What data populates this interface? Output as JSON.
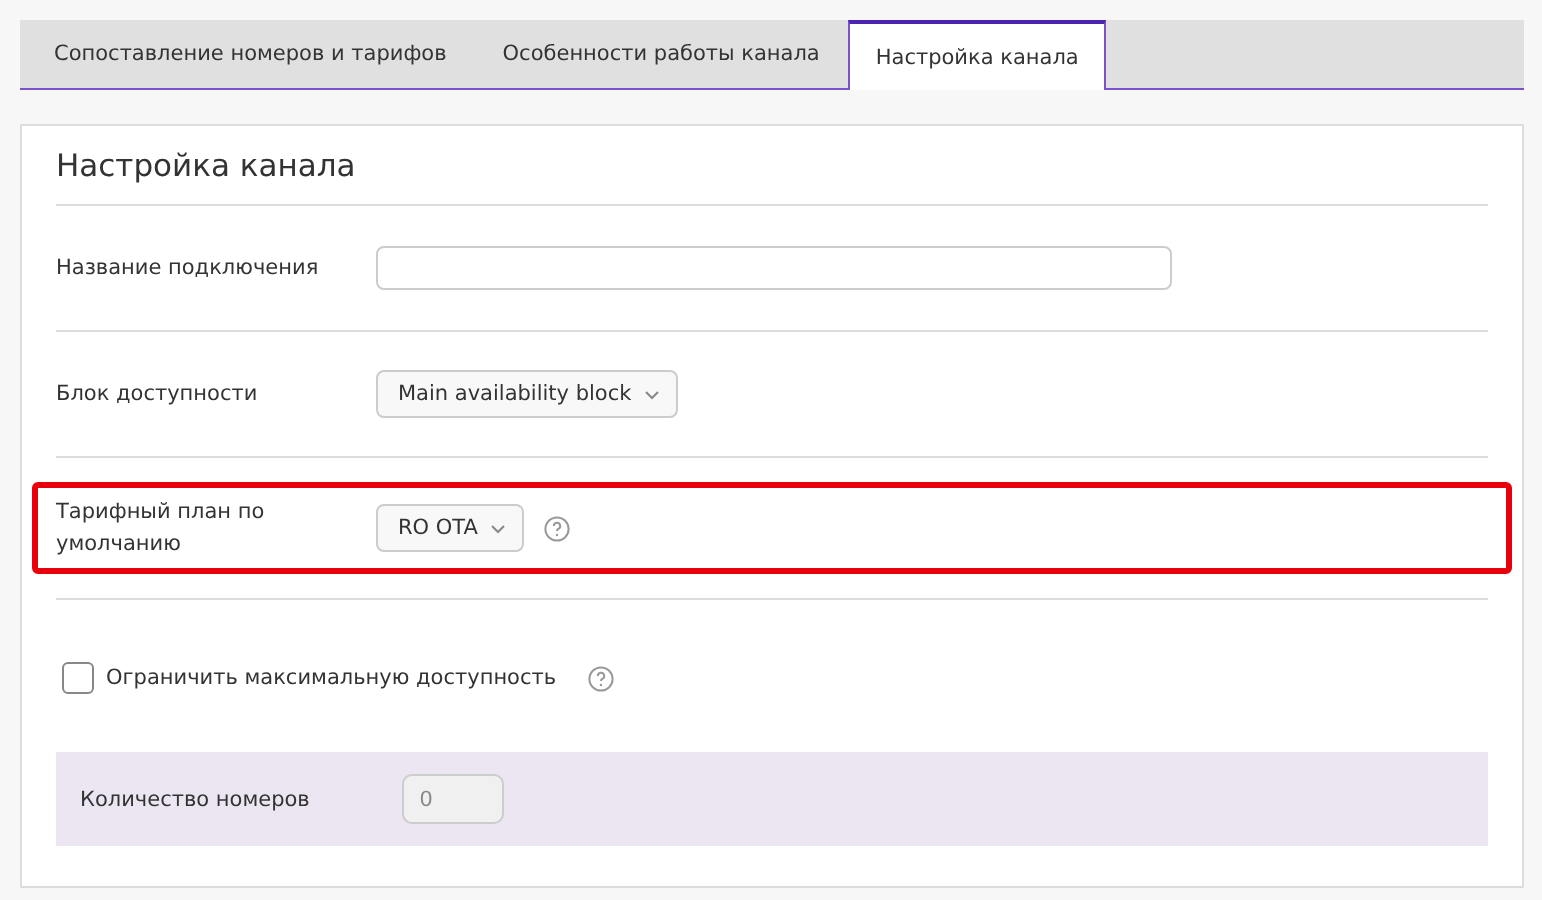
{
  "tabs": [
    {
      "label": "Сопоставление номеров и тарифов",
      "selected": false
    },
    {
      "label": "Особенности работы канала",
      "selected": false
    },
    {
      "label": "Настройка канала",
      "selected": true
    }
  ],
  "panel": {
    "title": "Настройка канала",
    "rows": [
      {
        "kind": "input",
        "label": "Название подключения",
        "value": "",
        "help": false,
        "highlighted": false
      },
      {
        "kind": "select",
        "label": "Блок доступности",
        "value": "Main availability block",
        "help": false,
        "highlighted": false
      },
      {
        "kind": "select",
        "label": "Тарифный план по умолчанию",
        "value": "RO OTA",
        "help": true,
        "highlighted": true
      }
    ],
    "limit": {
      "label": "Ограничить максимальную доступность",
      "checked": false,
      "help": true
    },
    "rooms": {
      "label": "Количество номеров",
      "value": "0",
      "disabled": true
    }
  }
}
